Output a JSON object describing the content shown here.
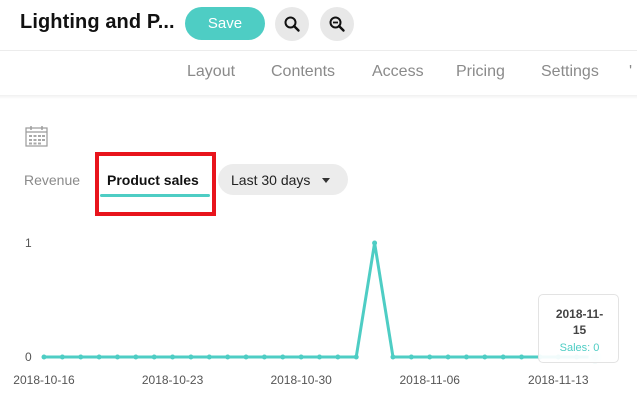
{
  "header": {
    "title": "Lighting and P...",
    "save_label": "Save"
  },
  "tabs": [
    {
      "label": "Layout"
    },
    {
      "label": "Contents"
    },
    {
      "label": "Access"
    },
    {
      "label": "Pricing"
    },
    {
      "label": "Settings"
    }
  ],
  "subtabs": {
    "revenue": "Revenue",
    "product_sales": "Product sales",
    "active": "Product sales"
  },
  "range_select": {
    "value": "Last 30 days"
  },
  "colors": {
    "accent": "#4ecdc4",
    "highlight": "#e8141c"
  },
  "icons": {
    "search": "search-icon",
    "zoom_out": "zoom-out-icon",
    "calendar": "calendar-icon"
  },
  "chart_data": {
    "type": "line",
    "x": [
      "2018-10-16",
      "2018-10-17",
      "2018-10-18",
      "2018-10-19",
      "2018-10-20",
      "2018-10-21",
      "2018-10-22",
      "2018-10-23",
      "2018-10-24",
      "2018-10-25",
      "2018-10-26",
      "2018-10-27",
      "2018-10-28",
      "2018-10-29",
      "2018-10-30",
      "2018-10-31",
      "2018-11-01",
      "2018-11-02",
      "2018-11-03",
      "2018-11-04",
      "2018-11-05",
      "2018-11-06",
      "2018-11-07",
      "2018-11-08",
      "2018-11-09",
      "2018-11-10",
      "2018-11-11",
      "2018-11-12",
      "2018-11-13",
      "2018-11-14",
      "2018-11-15"
    ],
    "series": [
      {
        "values": [
          0,
          0,
          0,
          0,
          0,
          0,
          0,
          0,
          0,
          0,
          0,
          0,
          0,
          0,
          0,
          0,
          0,
          0,
          1,
          0,
          0,
          0,
          0,
          0,
          0,
          0,
          0,
          0,
          0,
          0,
          0
        ]
      }
    ],
    "x_tick_labels": [
      "2018-10-16",
      "2018-10-23",
      "2018-10-30",
      "2018-11-06",
      "2018-11-13"
    ],
    "y_tick_labels": [
      "0",
      "1"
    ],
    "ylim": [
      0,
      1
    ],
    "grid": false,
    "tooltip": {
      "date_line1": "2018-11-",
      "date_line2": "15",
      "sales_label": "Sales: 0"
    }
  }
}
